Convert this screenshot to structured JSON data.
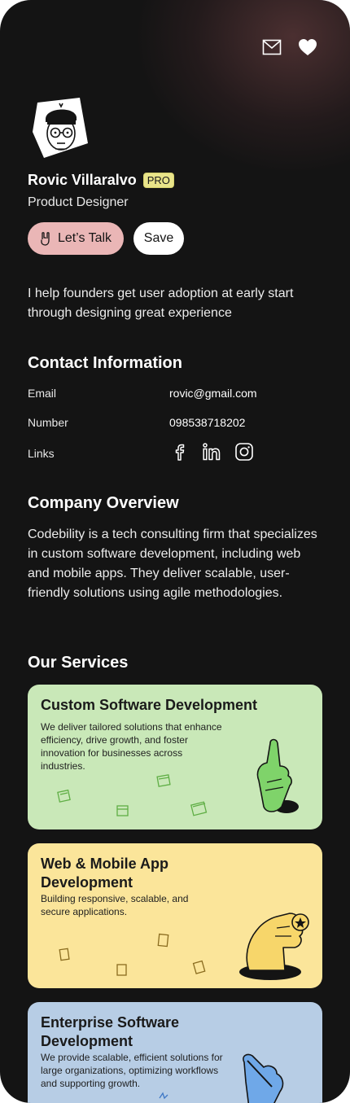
{
  "profile": {
    "name": "Rovic Villaralvo",
    "badge": "PRO",
    "role": "Product Designer",
    "talk_label": "Let’s Talk",
    "save_label": "Save",
    "bio": "I help founders get user adoption at early start through designing great experience"
  },
  "contact": {
    "title": "Contact Information",
    "email_label": "Email",
    "email_value": "rovic@gmail.com",
    "number_label": "Number",
    "number_value": "098538718202",
    "links_label": "Links",
    "link_icons": [
      "facebook-icon",
      "linkedin-icon",
      "instagram-icon"
    ]
  },
  "company": {
    "title": "Company Overview",
    "text": "Codebility is a tech consulting firm that specializes in custom software development, including web and mobile apps. They deliver scalable, user-friendly solutions using agile methodologies."
  },
  "services": {
    "title": "Our Services",
    "items": [
      {
        "title": "Custom Software Development",
        "desc": "We deliver tailored solutions that enhance efficiency, drive growth, and foster innovation for businesses across industries.",
        "color": "#c9e8b8"
      },
      {
        "title": "Web & Mobile App Development",
        "desc": "Building responsive, scalable, and secure applications.",
        "color": "#fbe59a"
      },
      {
        "title": "Enterprise Software Development",
        "desc": "We provide scalable, efficient solutions for large organizations, optimizing workflows and supporting growth.",
        "color": "#b7cde5"
      }
    ]
  },
  "colors": {
    "background": "#141414",
    "talk_button": "#eab6b6",
    "pro_badge": "#e9e48a"
  }
}
